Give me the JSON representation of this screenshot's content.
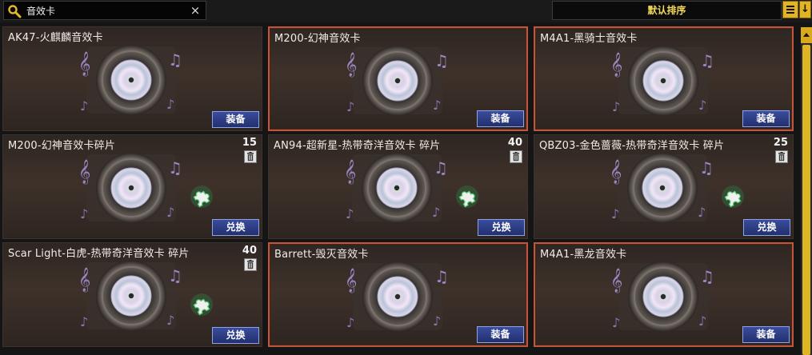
{
  "search": {
    "value": "音效卡",
    "clear_label": "×"
  },
  "sort": {
    "label": "默认排序"
  },
  "cards": [
    {
      "title": "AK47-火麒麟音效卡",
      "count": "",
      "button": "装备",
      "fragment": false,
      "selected": false
    },
    {
      "title": "M200-幻神音效卡",
      "count": "",
      "button": "装备",
      "fragment": false,
      "selected": true
    },
    {
      "title": "M4A1-黑骑士音效卡",
      "count": "",
      "button": "装备",
      "fragment": false,
      "selected": true
    },
    {
      "title": "M200-幻神音效卡碎片",
      "count": "15",
      "button": "兑换",
      "fragment": true,
      "selected": false
    },
    {
      "title": "AN94-超新星-热带奇洋音效卡 碎片",
      "count": "40",
      "button": "兑换",
      "fragment": true,
      "selected": false
    },
    {
      "title": "QBZ03-金色蔷薇-热带奇洋音效卡 碎片",
      "count": "25",
      "button": "兑换",
      "fragment": true,
      "selected": false
    },
    {
      "title": "Scar Light-白虎-热带奇洋音效卡 碎片",
      "count": "40",
      "button": "兑换",
      "fragment": true,
      "selected": false
    },
    {
      "title": "Barrett-毁灭音效卡",
      "count": "",
      "button": "装备",
      "fragment": false,
      "selected": true
    },
    {
      "title": "M4A1-黑龙音效卡",
      "count": "",
      "button": "装备",
      "fragment": false,
      "selected": true
    }
  ],
  "colors": {
    "accent": "#e0b422",
    "button": "#2a3a80",
    "selected_border": "#c0563c"
  }
}
